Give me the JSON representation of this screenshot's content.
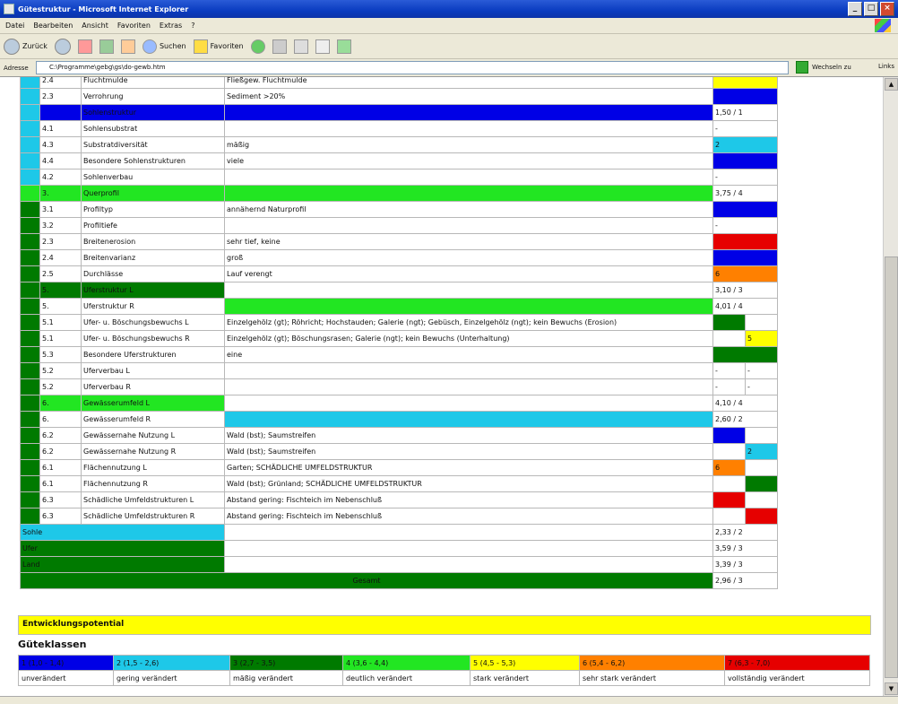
{
  "window": {
    "title": "Gütestruktur - Microsoft Internet Explorer"
  },
  "menu": [
    "Datei",
    "Bearbeiten",
    "Ansicht",
    "Favoriten",
    "Extras",
    "?"
  ],
  "toolbar": {
    "back": "Zurück",
    "search": "Suchen",
    "favorites": "Favoriten"
  },
  "address": {
    "label": "Adresse",
    "value": "C:\\Programme\\gebg\\gs\\do-gewb.htm",
    "go": "Wechseln zu",
    "links": "Links"
  },
  "colors": {
    "1": "#0000e6",
    "2": "#1ec8e8",
    "3": "#007a00",
    "4": "#22e622",
    "5": "#ffff00",
    "6": "#ff8000",
    "7": "#e60000",
    "none": "#ffffff"
  },
  "rows": [
    {
      "c0": "2",
      "c1": "2.4",
      "c2": "Fluchtmulde",
      "c3": "Fließgew. Fluchtmulde",
      "c2c": "none",
      "c3c": "none",
      "s": {
        "t": "full",
        "c": "5",
        "v": ""
      }
    },
    {
      "c0": "2",
      "c1": "2.3",
      "c2": "Verrohrung",
      "c3": "Sediment >20%",
      "c2c": "none",
      "c3c": "none",
      "s": {
        "t": "full",
        "c": "1",
        "v": ""
      }
    },
    {
      "c0": "2",
      "c1": "",
      "c2": "Sohlenstruktur",
      "c3": "",
      "c2c": "1",
      "c3c": "1",
      "s": {
        "t": "text",
        "v": "1,50 / 1"
      },
      "c1c": "1"
    },
    {
      "c0": "2",
      "c1": "4.1",
      "c2": "Sohlensubstrat",
      "c3": "",
      "c2c": "none",
      "c3c": "none",
      "s": {
        "t": "text",
        "v": "-"
      }
    },
    {
      "c0": "2",
      "c1": "4.3",
      "c2": "Substratdiversität",
      "c3": "mäßig",
      "c2c": "none",
      "c3c": "none",
      "s": {
        "t": "full",
        "c": "2",
        "v": "2"
      }
    },
    {
      "c0": "2",
      "c1": "4.4",
      "c2": "Besondere Sohlenstrukturen",
      "c3": "viele",
      "c2c": "none",
      "c3c": "none",
      "s": {
        "t": "full",
        "c": "1",
        "v": ""
      }
    },
    {
      "c0": "2",
      "c1": "4.2",
      "c2": "Sohlenverbau",
      "c3": "",
      "c2c": "none",
      "c3c": "none",
      "s": {
        "t": "text",
        "v": "-"
      }
    },
    {
      "c0": "4",
      "c1": "3.",
      "c2": "Querprofil",
      "c3": "",
      "c2c": "4",
      "c3c": "4",
      "s": {
        "t": "text",
        "v": "3,75 / 4"
      },
      "c1c": "4"
    },
    {
      "c0": "3",
      "c1": "3.1",
      "c2": "Profiltyp",
      "c3": "annähernd Naturprofil",
      "c2c": "none",
      "c3c": "none",
      "s": {
        "t": "full",
        "c": "1",
        "v": ""
      }
    },
    {
      "c0": "3",
      "c1": "3.2",
      "c2": "Profiltiefe",
      "c3": "",
      "c2c": "none",
      "c3c": "none",
      "s": {
        "t": "text",
        "v": "-"
      }
    },
    {
      "c0": "3",
      "c1": "2.3",
      "c2": "Breitenerosion",
      "c3": "sehr tief, keine",
      "c2c": "none",
      "c3c": "none",
      "s": {
        "t": "full",
        "c": "7",
        "v": ""
      }
    },
    {
      "c0": "3",
      "c1": "2.4",
      "c2": "Breitenvarianz",
      "c3": "groß",
      "c2c": "none",
      "c3c": "none",
      "s": {
        "t": "full",
        "c": "1",
        "v": ""
      }
    },
    {
      "c0": "3",
      "c1": "2.5",
      "c2": "Durchlässe",
      "c3": "Lauf verengt",
      "c2c": "none",
      "c3c": "none",
      "s": {
        "t": "full",
        "c": "6",
        "v": "6"
      }
    },
    {
      "c0": "3",
      "c1": "5.",
      "c2": "Uferstruktur L",
      "c3": "",
      "c2c": "3",
      "c3c": "none",
      "s": {
        "t": "text",
        "v": "3,10 / 3"
      },
      "c1c": "3"
    },
    {
      "c0": "3",
      "c1": "5.",
      "c2": "Uferstruktur R",
      "c3": "",
      "c2c": "none",
      "c3c": "4",
      "s": {
        "t": "text",
        "v": "4,01 / 4"
      }
    },
    {
      "c0": "3",
      "c1": "5.1",
      "c2": "Ufer- u. Böschungsbewuchs L",
      "c3": "Einzelgehölz (gt); Röhricht; Hochstauden; Galerie (ngt); Gebüsch, Einzelgehölz (ngt); kein Bewuchs (Erosion)",
      "c2c": "none",
      "c3c": "none",
      "s": {
        "t": "split",
        "l": "3",
        "r": "none",
        "lv": "",
        "rv": ""
      }
    },
    {
      "c0": "3",
      "c1": "5.1",
      "c2": "Ufer- u. Böschungsbewuchs R",
      "c3": "Einzelgehölz (gt); Böschungsrasen; Galerie (ngt); kein Bewuchs (Unterhaltung)",
      "c2c": "none",
      "c3c": "none",
      "s": {
        "t": "split",
        "l": "none",
        "r": "5",
        "lv": "",
        "rv": "5"
      }
    },
    {
      "c0": "3",
      "c1": "5.3",
      "c2": "Besondere Uferstrukturen",
      "c3": "eine",
      "c2c": "none",
      "c3c": "none",
      "s": {
        "t": "full",
        "c": "3",
        "v": ""
      }
    },
    {
      "c0": "3",
      "c1": "5.2",
      "c2": "Uferverbau L",
      "c3": "",
      "c2c": "none",
      "c3c": "none",
      "s": {
        "t": "split",
        "l": "none",
        "r": "none",
        "lv": "-",
        "rv": "-"
      }
    },
    {
      "c0": "3",
      "c1": "5.2",
      "c2": "Uferverbau R",
      "c3": "",
      "c2c": "none",
      "c3c": "none",
      "s": {
        "t": "split",
        "l": "none",
        "r": "none",
        "lv": "-",
        "rv": "-"
      }
    },
    {
      "c0": "3",
      "c1": "6.",
      "c2": "Gewässerumfeld L",
      "c3": "",
      "c2c": "4",
      "c3c": "none",
      "s": {
        "t": "text",
        "v": "4,10 / 4"
      },
      "c1c": "4"
    },
    {
      "c0": "3",
      "c1": "6.",
      "c2": "Gewässerumfeld R",
      "c3": "",
      "c2c": "none",
      "c3c": "2",
      "s": {
        "t": "text",
        "v": "2,60 / 2"
      }
    },
    {
      "c0": "3",
      "c1": "6.2",
      "c2": "Gewässernahe Nutzung L",
      "c3": "Wald (bst); Saumstreifen",
      "c2c": "none",
      "c3c": "none",
      "s": {
        "t": "split",
        "l": "1",
        "r": "none",
        "lv": "",
        "rv": ""
      }
    },
    {
      "c0": "3",
      "c1": "6.2",
      "c2": "Gewässernahe Nutzung R",
      "c3": "Wald (bst); Saumstreifen",
      "c2c": "none",
      "c3c": "none",
      "s": {
        "t": "split",
        "l": "none",
        "r": "2",
        "lv": "",
        "rv": "2"
      }
    },
    {
      "c0": "3",
      "c1": "6.1",
      "c2": "Flächennutzung L",
      "c3": "Garten; SCHÄDLICHE UMFELDSTRUKTUR",
      "c2c": "none",
      "c3c": "none",
      "s": {
        "t": "split",
        "l": "6",
        "r": "none",
        "lv": "6",
        "rv": ""
      }
    },
    {
      "c0": "3",
      "c1": "6.1",
      "c2": "Flächennutzung R",
      "c3": "Wald (bst); Grünland; SCHÄDLICHE UMFELDSTRUKTUR",
      "c2c": "none",
      "c3c": "none",
      "s": {
        "t": "split",
        "l": "none",
        "r": "3",
        "lv": "",
        "rv": ""
      }
    },
    {
      "c0": "3",
      "c1": "6.3",
      "c2": "Schädliche Umfeldstrukturen L",
      "c3": "Abstand gering: Fischteich im Nebenschluß",
      "c2c": "none",
      "c3c": "none",
      "s": {
        "t": "split",
        "l": "7",
        "r": "none",
        "lv": "",
        "rv": ""
      }
    },
    {
      "c0": "3",
      "c1": "6.3",
      "c2": "Schädliche Umfeldstrukturen R",
      "c3": "Abstand gering: Fischteich im Nebenschluß",
      "c2c": "none",
      "c3c": "none",
      "s": {
        "t": "split",
        "l": "none",
        "r": "7",
        "lv": "",
        "rv": ""
      }
    }
  ],
  "summary": [
    {
      "label": "Sohle",
      "color": "2",
      "value": "2,33 / 2"
    },
    {
      "label": "Ufer",
      "color": "3",
      "value": "3,59 / 3"
    },
    {
      "label": "Land",
      "color": "3",
      "value": "3,39 / 3"
    }
  ],
  "gesamt": {
    "label": "Gesamt",
    "value": "2,96 / 3"
  },
  "entwicklung": "Entwicklungspotential",
  "legend_title": "Güteklassen",
  "legend": [
    {
      "range": "1 (1,0 - 1,4)",
      "desc": "unverändert",
      "color": "1"
    },
    {
      "range": "2 (1,5 - 2,6)",
      "desc": "gering verändert",
      "color": "2"
    },
    {
      "range": "3 (2,7 - 3,5)",
      "desc": "mäßig verändert",
      "color": "3"
    },
    {
      "range": "4 (3,6 - 4,4)",
      "desc": "deutlich verändert",
      "color": "4"
    },
    {
      "range": "5 (4,5 - 5,3)",
      "desc": "stark verändert",
      "color": "5"
    },
    {
      "range": "6 (5,4 - 6,2)",
      "desc": "sehr stark verändert",
      "color": "6"
    },
    {
      "range": "7 (6,3 - 7,0)",
      "desc": "vollständig verändert",
      "color": "7"
    }
  ]
}
